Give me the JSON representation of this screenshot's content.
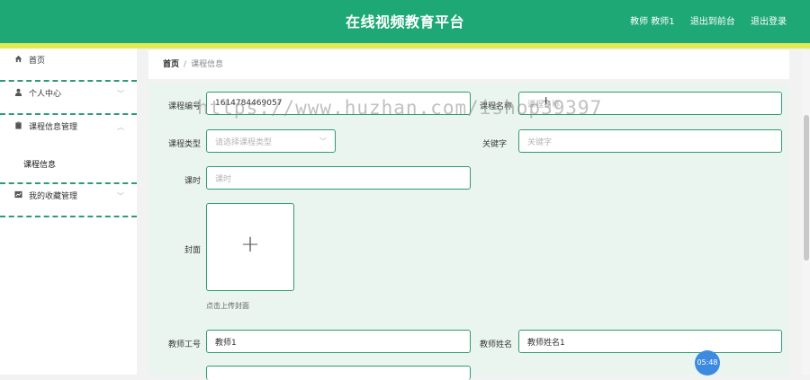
{
  "header": {
    "title": "在线视频教育平台",
    "user": "教师 教师1",
    "front_link": "退出到前台",
    "logout": "退出登录"
  },
  "sidebar": {
    "items": [
      {
        "label": "首页",
        "icon": "home-icon"
      },
      {
        "label": "个人中心",
        "icon": "user-icon",
        "arrow": "﹀"
      },
      {
        "label": "课程信息管理",
        "icon": "clipboard-icon",
        "arrow": "︿"
      },
      {
        "label": "我的收藏管理",
        "icon": "chart-icon",
        "arrow": "﹀"
      }
    ],
    "sub_item": "课程信息"
  },
  "breadcrumb": {
    "home": "首页",
    "separator": "/",
    "current": "课程信息"
  },
  "form": {
    "course_no_label": "课程编号",
    "course_no_value": "1614784469057",
    "course_name_label": "课程名称",
    "course_name_placeholder": "课程名称",
    "course_type_label": "课程类型",
    "course_type_placeholder": "请选择课程类型",
    "keyword_label": "关键字",
    "keyword_placeholder": "关键字",
    "hours_label": "课时",
    "hours_placeholder": "课时",
    "cover_label": "封面",
    "cover_plus": "+",
    "cover_hint": "点击上传封面",
    "teacher_no_label": "教师工号",
    "teacher_no_value": "教师1",
    "teacher_name_label": "教师姓名",
    "teacher_name_value": "教师姓名1"
  },
  "watermark": "https://www.huzhan.com/ishop39397",
  "timer": "05:48",
  "colors": {
    "primary": "#1ea875",
    "accent_bar": "#e3e853",
    "form_bg": "#e9f5ee",
    "border": "#2e9b72"
  }
}
